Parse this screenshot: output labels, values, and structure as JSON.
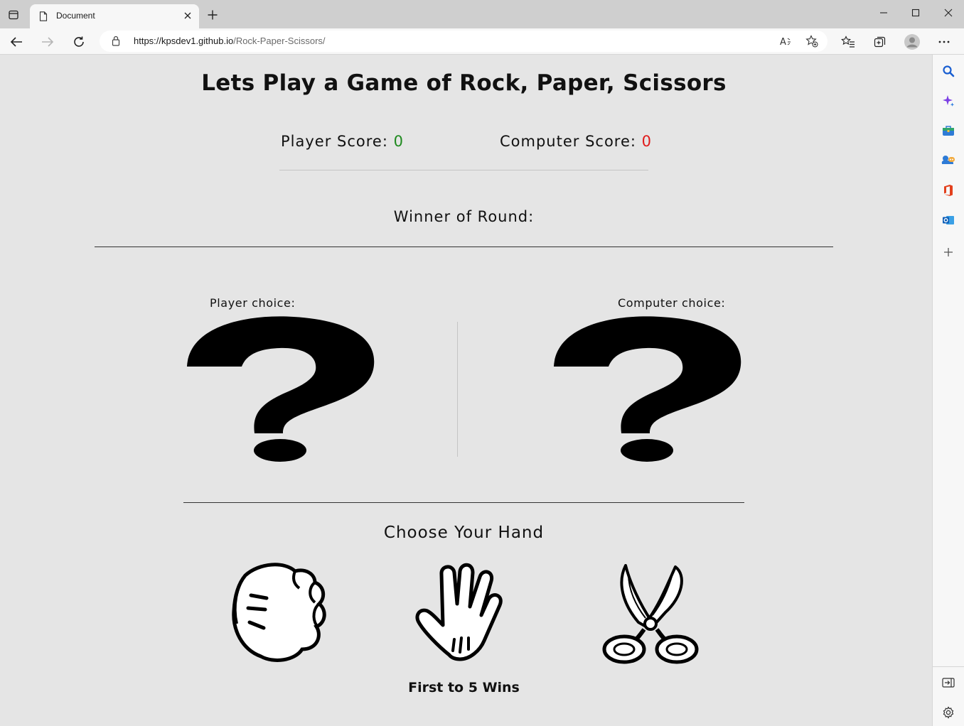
{
  "browser": {
    "tab_title": "Document",
    "url_host": "https://kpsdev1.github.io",
    "url_path": "/Rock-Paper-Scissors/"
  },
  "page": {
    "title": "Lets Play a Game of Rock, Paper, Scissors",
    "player_score_label": "Player Score: ",
    "player_score": "0",
    "computer_score_label": "Computer Score: ",
    "computer_score": "0",
    "winner_label": "Winner of Round:",
    "player_choice_label": "Player choice:",
    "computer_choice_label": "Computer choice:",
    "choose_heading": "Choose Your Hand",
    "hands": [
      "rock",
      "paper",
      "scissors"
    ],
    "footer": "First to 5 Wins"
  },
  "colors": {
    "player_score": "#1f8a1f",
    "computer_score": "#e01b1b",
    "page_bg": "#e5e5e5"
  }
}
